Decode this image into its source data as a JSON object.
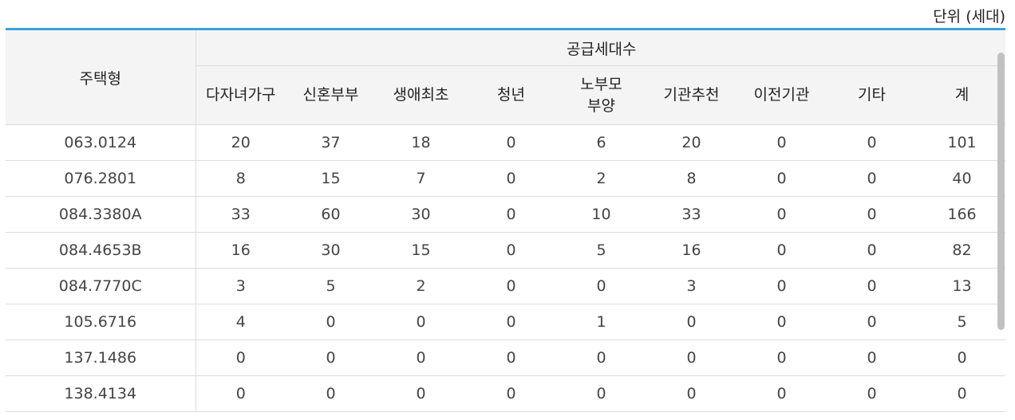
{
  "unit_label": "단위 (세대)",
  "header": {
    "type_label": "주택형",
    "group_label": "공급세대수",
    "columns": [
      "다자녀가구",
      "신혼부부",
      "생애최초",
      "청년",
      "노부모\n부양",
      "기관추천",
      "이전기관",
      "기타",
      "계"
    ]
  },
  "rows": [
    {
      "type": "063.0124",
      "values": [
        "20",
        "37",
        "18",
        "0",
        "6",
        "20",
        "0",
        "0",
        "101"
      ]
    },
    {
      "type": "076.2801",
      "values": [
        "8",
        "15",
        "7",
        "0",
        "2",
        "8",
        "0",
        "0",
        "40"
      ]
    },
    {
      "type": "084.3380A",
      "values": [
        "33",
        "60",
        "30",
        "0",
        "10",
        "33",
        "0",
        "0",
        "166"
      ]
    },
    {
      "type": "084.4653B",
      "values": [
        "16",
        "30",
        "15",
        "0",
        "5",
        "16",
        "0",
        "0",
        "82"
      ]
    },
    {
      "type": "084.7770C",
      "values": [
        "3",
        "5",
        "2",
        "0",
        "0",
        "3",
        "0",
        "0",
        "13"
      ]
    },
    {
      "type": "105.6716",
      "values": [
        "4",
        "0",
        "0",
        "0",
        "1",
        "0",
        "0",
        "0",
        "5"
      ]
    },
    {
      "type": "137.1486",
      "values": [
        "0",
        "0",
        "0",
        "0",
        "0",
        "0",
        "0",
        "0",
        "0"
      ]
    },
    {
      "type": "138.4134",
      "values": [
        "0",
        "0",
        "0",
        "0",
        "0",
        "0",
        "0",
        "0",
        "0"
      ]
    }
  ],
  "colors": {
    "accent": "#3ca0dc",
    "header_bg": "#f4f4f4",
    "border": "#dcdcdc"
  }
}
